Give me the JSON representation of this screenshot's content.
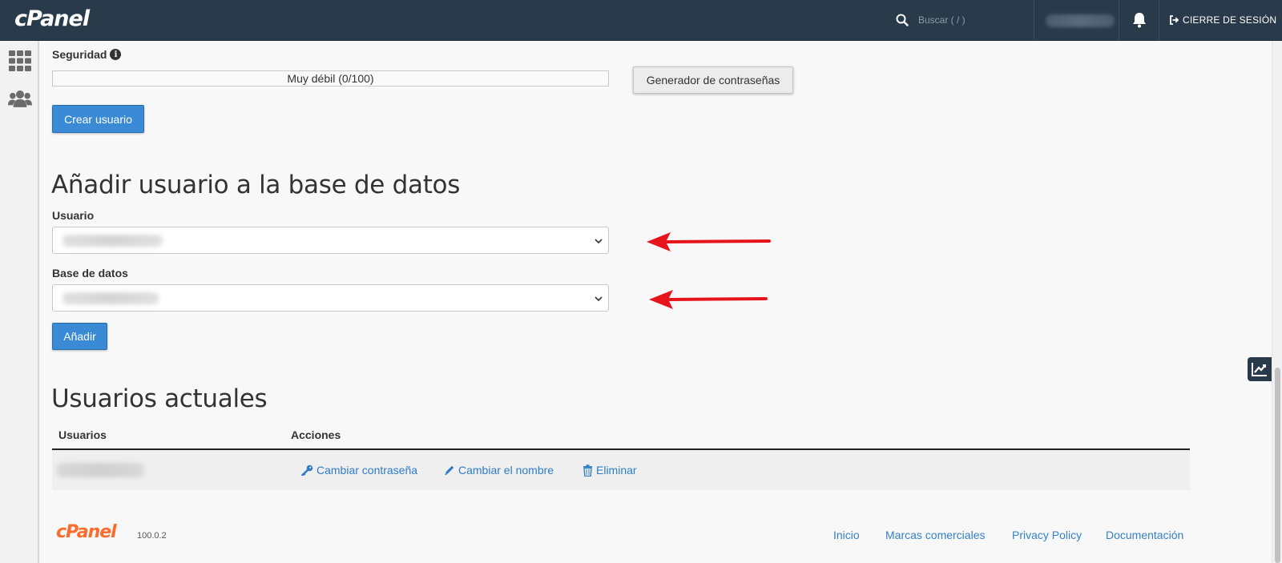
{
  "header": {
    "logo": "cPanel",
    "search_placeholder": "Buscar ( / )",
    "logout_label": "CIERRE DE SESIÓN"
  },
  "sidebar": {
    "items": [
      {
        "icon": "grid-icon"
      },
      {
        "icon": "users-icon"
      }
    ]
  },
  "password": {
    "security_label": "Seguridad",
    "strength_text": "Muy débil (0/100)",
    "strength_value": 0,
    "generator_label": "Generador de contraseñas",
    "create_label": "Crear usuario"
  },
  "add_user": {
    "title": "Añadir usuario a la base de datos",
    "user_label": "Usuario",
    "db_label": "Base de datos",
    "add_label": "Añadir"
  },
  "current_users": {
    "title": "Usuarios actuales",
    "columns": [
      "Usuarios",
      "Acciones"
    ],
    "actions": [
      {
        "label": "Cambiar contraseña",
        "icon": "key-icon"
      },
      {
        "label": "Cambiar el nombre",
        "icon": "pencil-icon"
      },
      {
        "label": "Eliminar",
        "icon": "trash-icon"
      }
    ]
  },
  "footer": {
    "logo": "cPanel",
    "version": "100.0.2",
    "links": [
      "Inicio",
      "Marcas comerciales",
      "Privacy Policy",
      "Documentación"
    ]
  },
  "colors": {
    "topbar": "#293a4a",
    "primary": "#3a8ad5",
    "link": "#2d7dc8",
    "annotation_arrow": "#e8141b"
  }
}
